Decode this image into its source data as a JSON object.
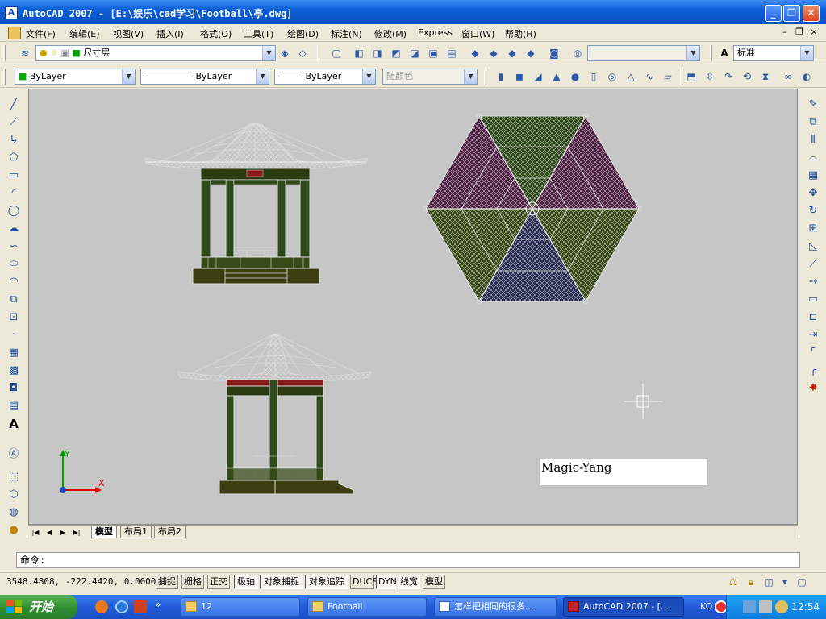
{
  "window": {
    "title": "AutoCAD 2007 - [E:\\娱乐\\cad学习\\Football\\亭.dwg]",
    "app_icon": "A",
    "buttons": [
      "minimize-icon",
      "maximize-icon",
      "close-icon"
    ]
  },
  "menubar": {
    "items": [
      "文件(F)",
      "编辑(E)",
      "视图(V)",
      "插入(I)",
      "格式(O)",
      "工具(T)",
      "绘图(D)",
      "标注(N)",
      "修改(M)",
      "Express",
      "窗口(W)",
      "帮助(H)"
    ],
    "doc_controls": [
      "–",
      "❐",
      "×"
    ]
  },
  "layers_toolbar": {
    "current_layer": "尺寸层",
    "text_style": "标准"
  },
  "properties_toolbar": {
    "color": "ByLayer",
    "linetype": "ByLayer",
    "lineweight": "ByLayer",
    "plotstyle": "随颜色"
  },
  "canvas": {
    "background": "#c6c6c6",
    "label_text": "Magic-Yang",
    "ucs": {
      "x_label": "X",
      "y_label": "Y"
    }
  },
  "layout_tabs": [
    "模型",
    "布局1",
    "布局2"
  ],
  "command": {
    "prompt": "命令:"
  },
  "statusbar": {
    "coords": "3548.4808, -222.4420, 0.0000",
    "toggles": [
      {
        "label": "捕捉",
        "on": false
      },
      {
        "label": "栅格",
        "on": false
      },
      {
        "label": "正交",
        "on": false
      },
      {
        "label": "极轴",
        "on": true
      },
      {
        "label": "对象捕捉",
        "on": true
      },
      {
        "label": "对象追踪",
        "on": true
      },
      {
        "label": "DUCS",
        "on": false
      },
      {
        "label": "DYN",
        "on": true
      },
      {
        "label": "线宽",
        "on": true
      },
      {
        "label": "模型",
        "on": false
      }
    ]
  },
  "taskbar": {
    "start_label": "开始",
    "tasks": [
      {
        "label": "12",
        "active": false
      },
      {
        "label": "Football",
        "active": false
      },
      {
        "label": "怎样把相同的很多...",
        "active": false
      },
      {
        "label": "AutoCAD 2007 - [...",
        "active": true
      }
    ],
    "ime": "KO",
    "clock": "12:54"
  }
}
